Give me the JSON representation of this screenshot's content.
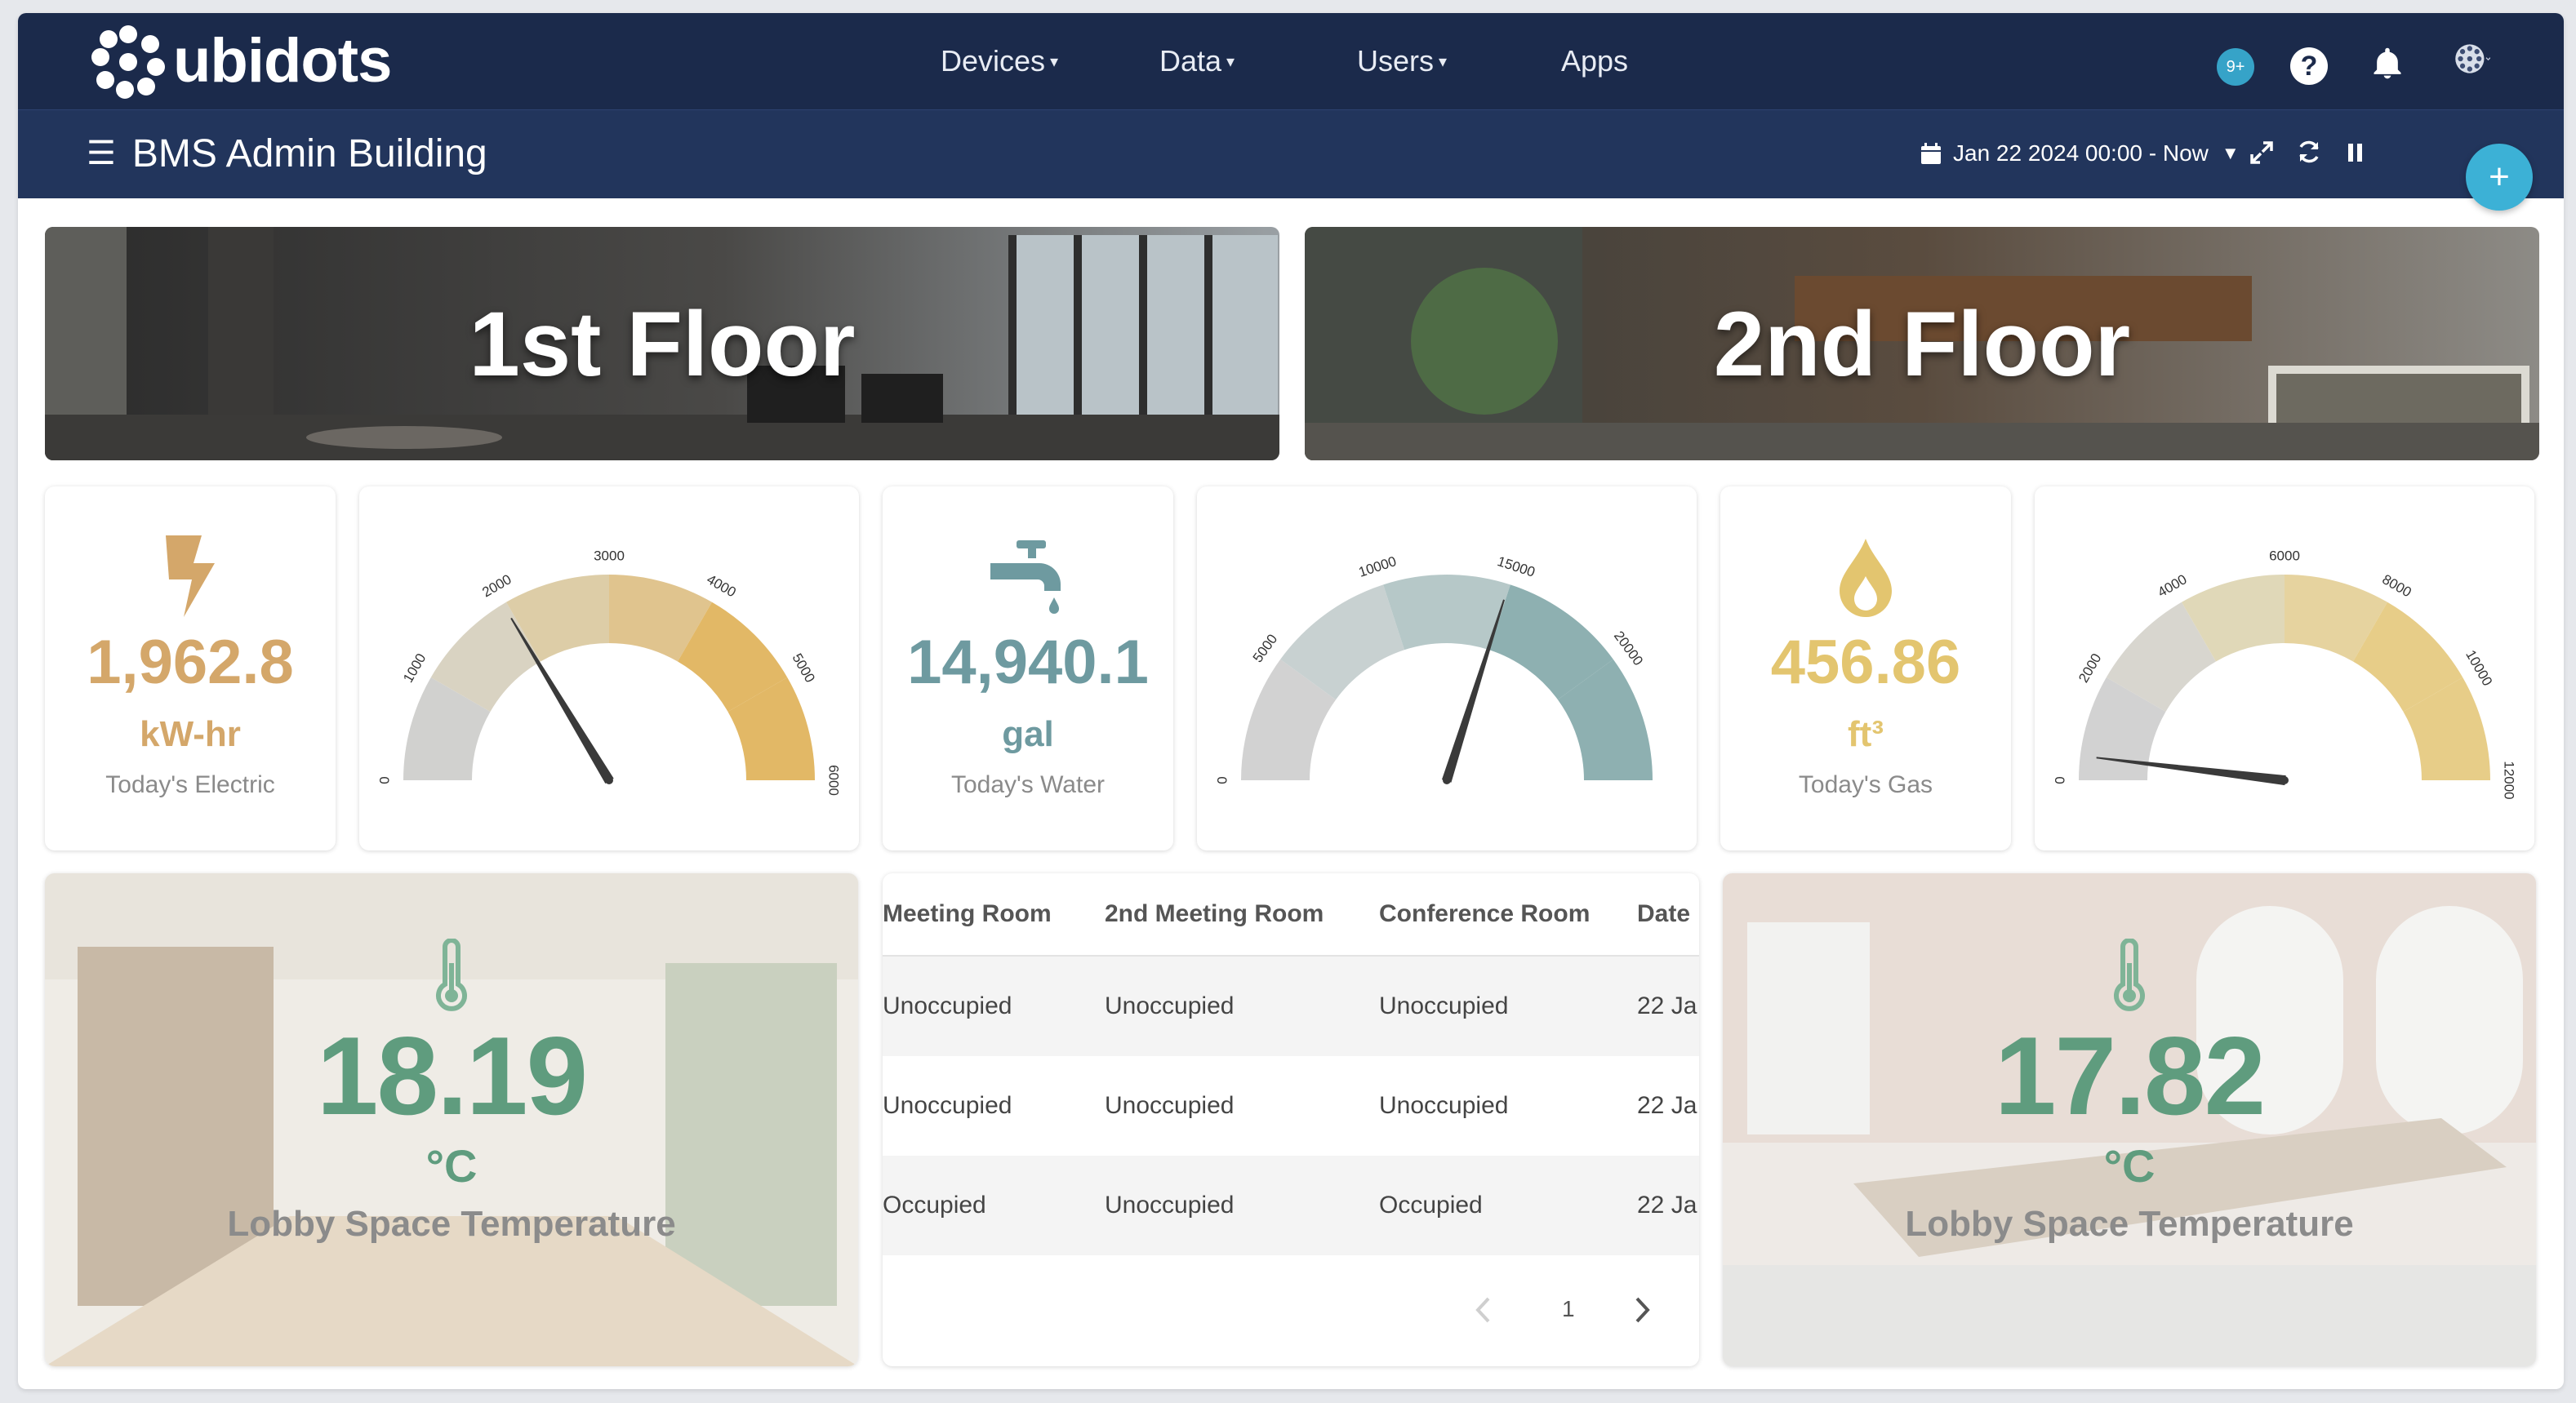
{
  "app": {
    "brand": "ubidots",
    "nav": [
      "Devices",
      "Data",
      "Users",
      "Apps"
    ],
    "nav_has_caret": [
      true,
      true,
      true,
      false
    ],
    "notifications_badge": "9+",
    "help_label": "?"
  },
  "dashboard": {
    "title": "BMS Admin Building",
    "date_range": "Jan 22 2024 00:00 - Now",
    "add_label": "+"
  },
  "banners": [
    {
      "label": "1st Floor"
    },
    {
      "label": "2nd Floor"
    }
  ],
  "metrics": [
    {
      "value": "1,962.8",
      "unit": "kW-hr",
      "caption": "Today's Electric",
      "color": "#d4a76a",
      "icon": "lightning-icon"
    },
    {
      "value": "14,940.1",
      "unit": "gal",
      "caption": "Today's Water",
      "color": "#6e9aa0",
      "icon": "faucet-icon"
    },
    {
      "value": "456.86",
      "unit": "ft³",
      "caption": "Today's Gas",
      "color": "#e3c56f",
      "icon": "flame-drop-icon"
    }
  ],
  "gauges": [
    {
      "name": "electric-gauge",
      "min": 0,
      "max": 6000,
      "value": 1962.8,
      "ticks": [
        "0",
        "1000",
        "2000",
        "3000",
        "4000",
        "5000",
        "6000"
      ],
      "bands": [
        "#d1d1cf",
        "#d9d3c2",
        "#ddcda7",
        "#e0c48e",
        "#e2b866",
        "#e2b866"
      ],
      "needle": "#3a3a3a"
    },
    {
      "name": "water-gauge",
      "min": 0,
      "max": 25000,
      "value": 14940.1,
      "ticks": [
        "0",
        "5000",
        "10000",
        "15000",
        "20000"
      ],
      "bands": [
        "#d2d2d2",
        "#c8d1d1",
        "#b6c8c8",
        "#8eb0b1",
        "#8eb0b1"
      ],
      "needle": "#3a3a3a"
    },
    {
      "name": "gas-gauge",
      "min": 0,
      "max": 12000,
      "value": 456.86,
      "ticks": [
        "0",
        "2000",
        "4000",
        "6000",
        "8000",
        "10000",
        "12000"
      ],
      "bands": [
        "#d2d2d2",
        "#d8d6cf",
        "#e0d8b8",
        "#e6d39f",
        "#e7cd88",
        "#e7cd88"
      ],
      "needle": "#3a3a3a"
    }
  ],
  "temps": [
    {
      "value": "18.19",
      "unit": "°C",
      "label": "Lobby Space Temperature"
    },
    {
      "value": "17.82",
      "unit": "°C",
      "label": "Lobby Space Temperature"
    }
  ],
  "table": {
    "columns": [
      "Meeting Room",
      "2nd Meeting Room",
      "Conference Room",
      "Date"
    ],
    "rows": [
      [
        "Unoccupied",
        "Unoccupied",
        "Unoccupied",
        "22 Ja"
      ],
      [
        "Unoccupied",
        "Unoccupied",
        "Unoccupied",
        "22 Ja"
      ],
      [
        "Occupied",
        "Unoccupied",
        "Occupied",
        "22 Ja"
      ]
    ],
    "page": "1"
  }
}
